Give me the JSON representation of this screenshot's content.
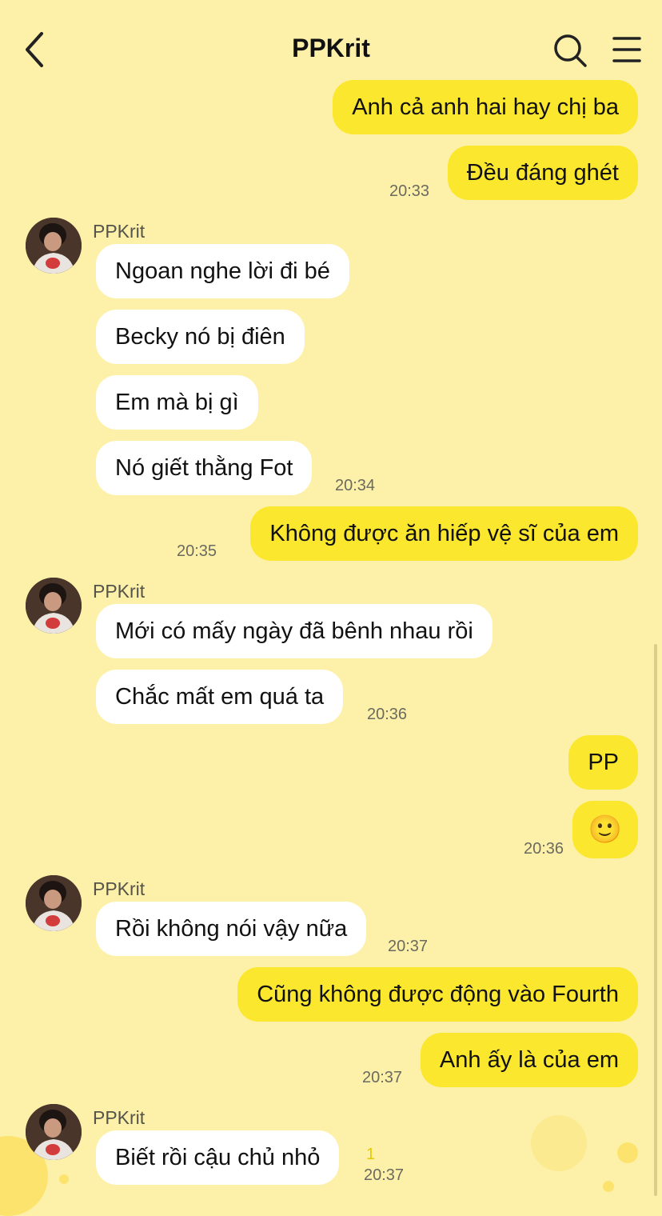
{
  "header": {
    "title": "PPKrit"
  },
  "contact": {
    "name": "PPKrit"
  },
  "messages": [
    {
      "text": "Anh cả anh hai hay chị ba"
    },
    {
      "text": "Đều đáng ghét",
      "time": "20:33"
    },
    {
      "text": "Ngoan nghe lời đi bé"
    },
    {
      "text": "Becky nó bị điên"
    },
    {
      "text": "Em mà bị gì"
    },
    {
      "text": "Nó giết thằng Fot",
      "time": "20:34"
    },
    {
      "text": "Không được ăn hiếp vệ sĩ của em",
      "time": "20:35"
    },
    {
      "text": "Mới có mấy ngày đã bênh nhau rồi"
    },
    {
      "text": "Chắc mất em quá ta",
      "time": "20:36"
    },
    {
      "text": "PP"
    },
    {
      "text": "🙂",
      "time": "20:36"
    },
    {
      "text": "Rồi không nói vậy nữa",
      "time": "20:37"
    },
    {
      "text": "Cũng không được động vào Fourth"
    },
    {
      "text": "Anh ấy là của em",
      "time": "20:37"
    },
    {
      "text": "Biết rồi cậu chủ nhỏ",
      "time": "20:37",
      "unread": "1"
    }
  ],
  "colors": {
    "background": "#FDF1AA",
    "outgoing": "#FBE72D",
    "incoming": "#FFFFFF"
  },
  "icons": {
    "back": "chevron-left-icon",
    "search": "search-icon",
    "menu": "menu-icon"
  }
}
